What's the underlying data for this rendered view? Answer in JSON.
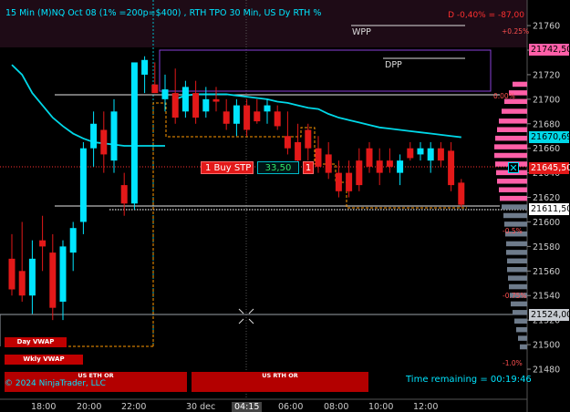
{
  "chart_title": "15 Min (M)NQ Oct 08 (1% =200p=$400) , RTH TPO 30 Min, US Dy RTH %",
  "pnl_label": "D -0,40% = -87,00",
  "level_labels": {
    "wpp": "WPP",
    "dpp": "DPP",
    "day_vwap": "Day VWAP",
    "wkly_vwap": "Wkly VWAP"
  },
  "pct_labels": [
    "+0.25%",
    "0.00%",
    "-0.5%",
    "-0.75%",
    "-1.0%"
  ],
  "order": {
    "type": "1 Buy STP",
    "price": "33,50",
    "qty": "1"
  },
  "price_tags": {
    "pink": "21742,50",
    "cyan": "21670,69",
    "red": "21645,50",
    "white": "21611,50",
    "gray": "21524,00"
  },
  "sessions": {
    "eth": "US ETH OR",
    "rth": "US RTH OR"
  },
  "time_remaining": "Time remaining = 00:19:46",
  "copyright": "© 2024 NinjaTrader, LLC",
  "x_labels": [
    "18:00",
    "20:00",
    "22:00",
    "30 dec",
    "04:15",
    "06:00",
    "08:00",
    "10:00",
    "12:00"
  ],
  "colors": {
    "background": "#000000",
    "up": "#00e5ff",
    "down": "#e31919",
    "vwap": "#00d8e8",
    "profile": "#ff5fa8",
    "profile_low": "#6e7b8b"
  },
  "chart_data": {
    "type": "candlestick",
    "y_ticks": [
      21760,
      21740,
      21720,
      21700,
      21680,
      21660,
      21640,
      21620,
      21600,
      21580,
      21560,
      21540,
      21520,
      21500,
      21480
    ],
    "ylim": [
      21475,
      21780
    ],
    "candles": [
      {
        "o": 21570,
        "h": 21590,
        "l": 21540,
        "c": 21545
      },
      {
        "o": 21560,
        "h": 21600,
        "l": 21535,
        "c": 21540
      },
      {
        "o": 21540,
        "h": 21585,
        "l": 21525,
        "c": 21570
      },
      {
        "o": 21585,
        "h": 21605,
        "l": 21560,
        "c": 21580
      },
      {
        "o": 21575,
        "h": 21590,
        "l": 21520,
        "c": 21530
      },
      {
        "o": 21535,
        "h": 21585,
        "l": 21520,
        "c": 21580
      },
      {
        "o": 21575,
        "h": 21600,
        "l": 21560,
        "c": 21595
      },
      {
        "o": 21600,
        "h": 21665,
        "l": 21590,
        "c": 21660
      },
      {
        "o": 21660,
        "h": 21690,
        "l": 21645,
        "c": 21680
      },
      {
        "o": 21675,
        "h": 21690,
        "l": 21640,
        "c": 21655
      },
      {
        "o": 21650,
        "h": 21700,
        "l": 21640,
        "c": 21690
      },
      {
        "o": 21630,
        "h": 21640,
        "l": 21605,
        "c": 21615
      },
      {
        "o": 21615,
        "h": 21730,
        "l": 21610,
        "c": 21730
      },
      {
        "o": 21720,
        "h": 21735,
        "l": 21705,
        "c": 21732
      },
      {
        "o": 21712,
        "h": 21730,
        "l": 21705,
        "c": 21705
      },
      {
        "o": 21700,
        "h": 21720,
        "l": 21690,
        "c": 21708
      },
      {
        "o": 21705,
        "h": 21725,
        "l": 21680,
        "c": 21685
      },
      {
        "o": 21690,
        "h": 21715,
        "l": 21685,
        "c": 21710
      },
      {
        "o": 21705,
        "h": 21715,
        "l": 21680,
        "c": 21685
      },
      {
        "o": 21690,
        "h": 21710,
        "l": 21685,
        "c": 21700
      },
      {
        "o": 21700,
        "h": 21710,
        "l": 21690,
        "c": 21698
      },
      {
        "o": 21690,
        "h": 21700,
        "l": 21675,
        "c": 21680
      },
      {
        "o": 21680,
        "h": 21700,
        "l": 21670,
        "c": 21695
      },
      {
        "o": 21695,
        "h": 21700,
        "l": 21670,
        "c": 21675
      },
      {
        "o": 21690,
        "h": 21700,
        "l": 21680,
        "c": 21682
      },
      {
        "o": 21690,
        "h": 21700,
        "l": 21680,
        "c": 21695
      },
      {
        "o": 21690,
        "h": 21695,
        "l": 21675,
        "c": 21678
      },
      {
        "o": 21670,
        "h": 21690,
        "l": 21655,
        "c": 21660
      },
      {
        "o": 21665,
        "h": 21680,
        "l": 21640,
        "c": 21650
      },
      {
        "o": 21675,
        "h": 21680,
        "l": 21650,
        "c": 21660
      },
      {
        "o": 21660,
        "h": 21670,
        "l": 21640,
        "c": 21645
      },
      {
        "o": 21655,
        "h": 21665,
        "l": 21635,
        "c": 21640
      },
      {
        "o": 21640,
        "h": 21650,
        "l": 21620,
        "c": 21625
      },
      {
        "o": 21640,
        "h": 21650,
        "l": 21620,
        "c": 21625
      },
      {
        "o": 21650,
        "h": 21660,
        "l": 21625,
        "c": 21630
      },
      {
        "o": 21660,
        "h": 21665,
        "l": 21640,
        "c": 21645
      },
      {
        "o": 21650,
        "h": 21660,
        "l": 21630,
        "c": 21640
      },
      {
        "o": 21650,
        "h": 21660,
        "l": 21640,
        "c": 21645
      },
      {
        "o": 21640,
        "h": 21655,
        "l": 21630,
        "c": 21650
      },
      {
        "o": 21660,
        "h": 21665,
        "l": 21650,
        "c": 21652
      },
      {
        "o": 21655,
        "h": 21665,
        "l": 21650,
        "c": 21660
      },
      {
        "o": 21650,
        "h": 21665,
        "l": 21640,
        "c": 21660
      },
      {
        "o": 21660,
        "h": 21665,
        "l": 21645,
        "c": 21650
      },
      {
        "o": 21658,
        "h": 21665,
        "l": 21625,
        "c": 21630
      },
      {
        "o": 21632,
        "h": 21635,
        "l": 21612,
        "c": 21614
      }
    ],
    "vwap": [
      21728,
      21720,
      21705,
      21695,
      21685,
      21678,
      21672,
      21668,
      21665,
      21664,
      21663,
      21662,
      21662,
      21662,
      21662,
      21662,
      21700,
      21703,
      21704,
      21704,
      21704,
      21704,
      21703,
      21702,
      21701,
      21700,
      21698,
      21697,
      21695,
      21693,
      21692,
      21688,
      21685,
      21683,
      21681,
      21679,
      21677,
      21676,
      21675,
      21674,
      21673,
      21672,
      21671,
      21670,
      21669
    ],
    "h_lines": {
      "wpp": 21738,
      "dpp": 21728,
      "white": 21611.5,
      "gray": 21524,
      "orange": 21614
    }
  }
}
